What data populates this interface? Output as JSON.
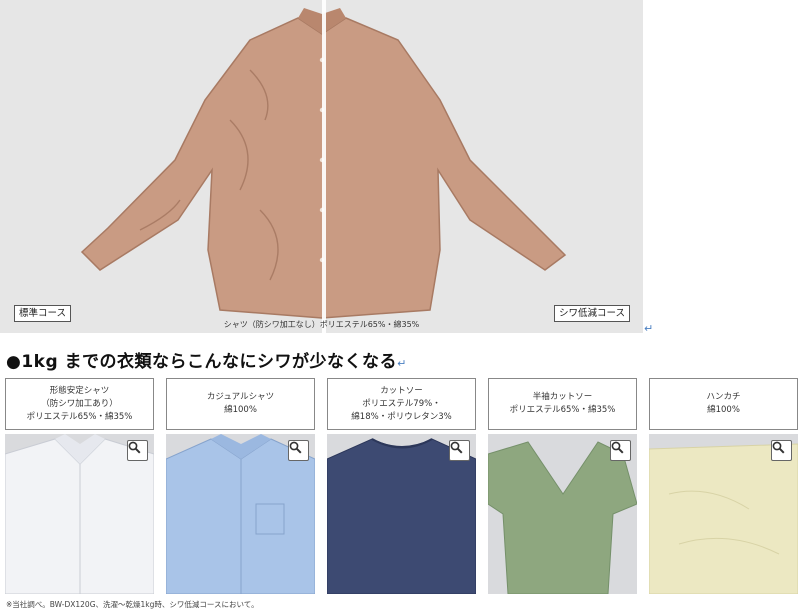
{
  "hero": {
    "left_label": "標準コース",
    "right_label": "シワ低減コース",
    "caption": "シャツ（防シワ加工なし）ポリエステル65%・綿35%",
    "shirt_color": "#c99b83"
  },
  "return_mark": "↵",
  "heading": "●1kg までの衣類ならこんなにシワが少なくなる",
  "cards": [
    {
      "lines": [
        "形態安定シャツ",
        "（防シワ加工あり）",
        "ポリエステル65%・綿35%"
      ],
      "color": "#f2f3f6"
    },
    {
      "lines": [
        "カジュアルシャツ",
        "綿100%",
        ""
      ],
      "color": "#a9c4e8"
    },
    {
      "lines": [
        "カットソー",
        "ポリエステル79%・",
        "綿18%・ポリウレタン3%"
      ],
      "color": "#3d4a72"
    },
    {
      "lines": [
        "半袖カットソー",
        "ポリエステル65%・綿35%",
        ""
      ],
      "color": "#8ea77f"
    },
    {
      "lines": [
        "ハンカチ",
        "綿100%",
        ""
      ],
      "color": "#ece8c2"
    }
  ],
  "zoom_icon": "magnifier-icon",
  "footnote": "※当社調べ。BW-DX120G、洗濯〜乾燥1kg時、シワ低減コースにおいて。"
}
